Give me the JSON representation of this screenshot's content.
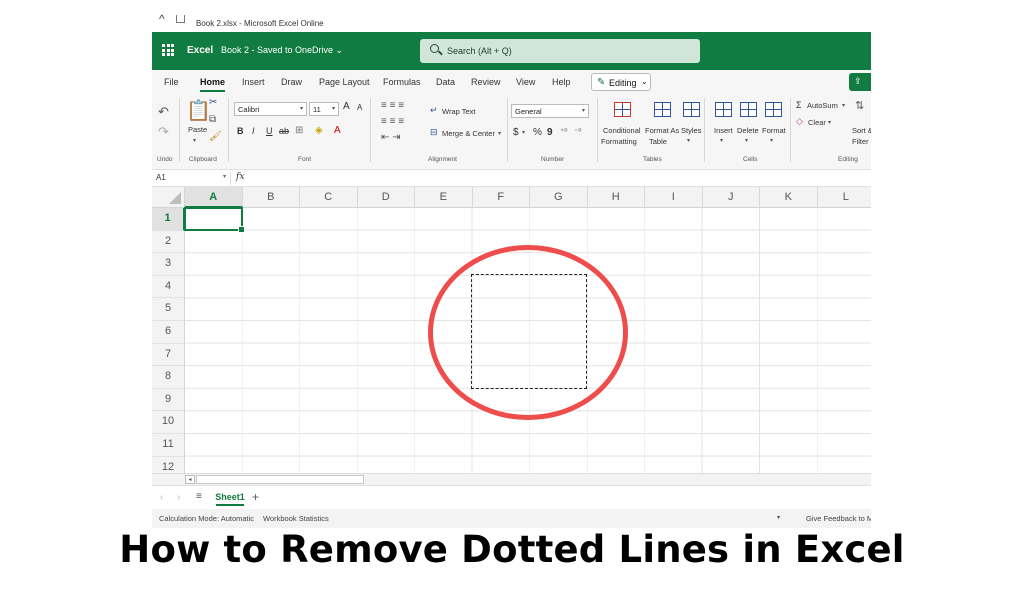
{
  "browser": {
    "title": "Book 2.xlsx - Microsoft Excel Online"
  },
  "header": {
    "app_name": "Excel",
    "doc_name": "Book 2 - Saved to OneDrive ⌄",
    "search_placeholder": "Search (Alt + Q)"
  },
  "tabs": [
    "File",
    "Home",
    "Insert",
    "Draw",
    "Page Layout",
    "Formulas",
    "Data",
    "Review",
    "View",
    "Help"
  ],
  "active_tab": "Home",
  "editing_mode": "Editing",
  "ribbon": {
    "undo_group": "Undo",
    "clipboard": {
      "paste": "Paste",
      "label": "Clipboard"
    },
    "font": {
      "name": "Calibri",
      "size": "11",
      "label": "Font",
      "bold": "B",
      "italic": "I",
      "underline": "U",
      "strike": "ab",
      "grow": "A",
      "shrink": "A"
    },
    "alignment": {
      "wrap": "Wrap Text",
      "merge": "Merge & Center",
      "label": "Alignment"
    },
    "number": {
      "format": "General",
      "currency": "$",
      "percent": "%",
      "comma": "9",
      "label": "Number"
    },
    "tables": {
      "conditional": "Conditional",
      "formatting": "Formatting",
      "format_as": "Format As",
      "table": "Table",
      "styles": "Styles",
      "label": "Tables"
    },
    "cells": {
      "insert": "Insert",
      "delete": "Delete",
      "format": "Format",
      "label": "Cells"
    },
    "editing": {
      "autosum": "AutoSum",
      "clear": "Clear",
      "sort": "Sort &",
      "filter": "Filter",
      "label": "Editing"
    }
  },
  "formula_bar": {
    "name_box": "A1",
    "fx": "fx",
    "value": ""
  },
  "columns": [
    "A",
    "B",
    "C",
    "D",
    "E",
    "F",
    "G",
    "H",
    "I",
    "J",
    "K",
    "L"
  ],
  "rows": [
    "1",
    "2",
    "3",
    "4",
    "5",
    "6",
    "7",
    "8",
    "9",
    "10",
    "11",
    "12"
  ],
  "selected_cell": "A1",
  "sheets": [
    "Sheet1"
  ],
  "status_bar": {
    "calc_mode": "Calculation Mode: Automatic",
    "stats": "Workbook Statistics",
    "feedback": "Give Feedback to Mi"
  },
  "caption": "How to Remove Dotted Lines in Excel",
  "colors": {
    "excel_green": "#107c41",
    "highlight_ring": "#ef4c4c"
  }
}
